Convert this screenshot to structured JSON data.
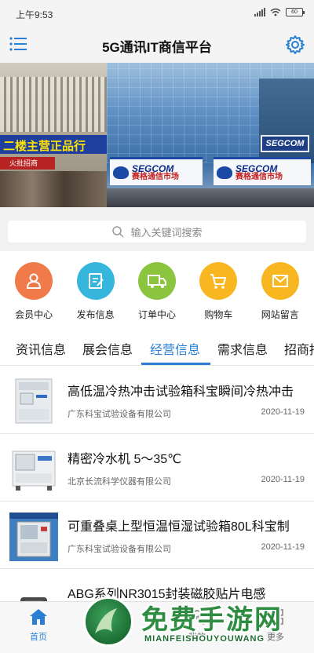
{
  "status": {
    "time": "上午9:53",
    "battery": "60"
  },
  "header": {
    "title": "5G通讯IT商信平台"
  },
  "banner": {
    "sign_text": "二楼主营正品行",
    "left_red_sign": "火批招商",
    "store_en": "SEGCOM",
    "store_cn": "赛格通信市场",
    "slide_count": 5,
    "active_slide": 1
  },
  "search": {
    "placeholder": "输入关键词搜索"
  },
  "quick_menu": [
    {
      "label": "会员中心",
      "icon": "user-icon",
      "color": "#f07a4a"
    },
    {
      "label": "发布信息",
      "icon": "edit-icon",
      "color": "#37b6dd"
    },
    {
      "label": "订单中心",
      "icon": "truck-icon",
      "color": "#8bc53f"
    },
    {
      "label": "购物车",
      "icon": "cart-icon",
      "color": "#f8b621"
    },
    {
      "label": "网站留言",
      "icon": "mail-icon",
      "color": "#f8b621"
    }
  ],
  "tabs": [
    {
      "label": "资讯信息",
      "active": false
    },
    {
      "label": "展会信息",
      "active": false
    },
    {
      "label": "经营信息",
      "active": true
    },
    {
      "label": "需求信息",
      "active": false
    },
    {
      "label": "招商招",
      "active": false
    }
  ],
  "listings": [
    {
      "title": "高低温冷热冲击试验箱科宝瞬间冷热冲击",
      "company": "广东科宝试验设备有限公司",
      "date": "2020-11-19"
    },
    {
      "title": "精密冷水机 5～35℃",
      "company": "北京长流科学仪器有限公司",
      "date": "2020-11-19"
    },
    {
      "title": "可重叠桌上型恒温恒湿试验箱80L科宝制",
      "company": "广东科宝试验设备有限公司",
      "date": "2020-11-19"
    },
    {
      "title": "ABG系列NR3015封装磁胶贴片电感",
      "company": "",
      "date": ""
    }
  ],
  "bottom_nav": [
    {
      "label": "首页",
      "icon": "home-icon",
      "active": true
    },
    {
      "label": "我的",
      "icon": "user-icon",
      "active": false
    },
    {
      "label": "更多",
      "icon": "more-icon",
      "active": false
    }
  ],
  "watermark": {
    "title": "免费手游网",
    "subtitle": "MIANFEISHOUYOUWANG"
  },
  "colors": {
    "accent": "#2a7fd4",
    "status_bg": "#f4f4f4"
  }
}
